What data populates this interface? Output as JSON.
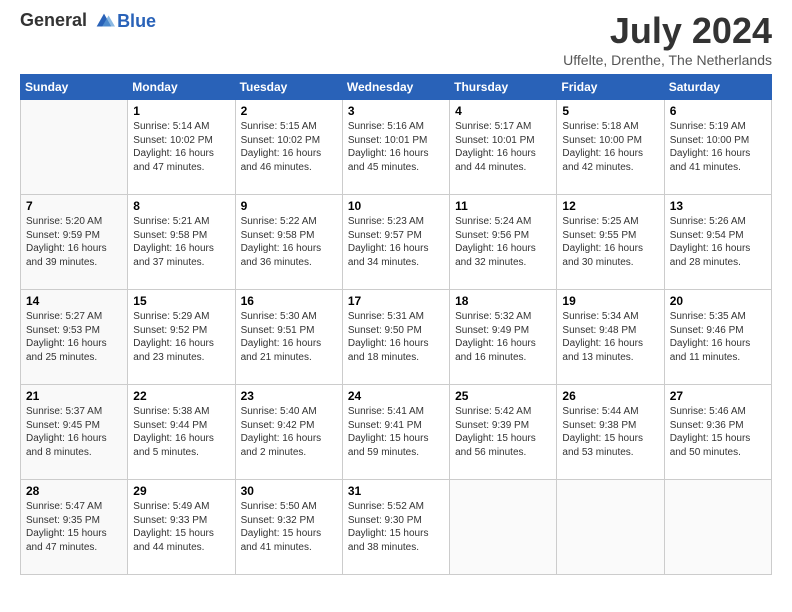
{
  "header": {
    "logo_line1": "General",
    "logo_line2": "Blue",
    "month": "July 2024",
    "location": "Uffelte, Drenthe, The Netherlands"
  },
  "days_of_week": [
    "Sunday",
    "Monday",
    "Tuesday",
    "Wednesday",
    "Thursday",
    "Friday",
    "Saturday"
  ],
  "weeks": [
    [
      {
        "num": "",
        "info": ""
      },
      {
        "num": "1",
        "info": "Sunrise: 5:14 AM\nSunset: 10:02 PM\nDaylight: 16 hours\nand 47 minutes."
      },
      {
        "num": "2",
        "info": "Sunrise: 5:15 AM\nSunset: 10:02 PM\nDaylight: 16 hours\nand 46 minutes."
      },
      {
        "num": "3",
        "info": "Sunrise: 5:16 AM\nSunset: 10:01 PM\nDaylight: 16 hours\nand 45 minutes."
      },
      {
        "num": "4",
        "info": "Sunrise: 5:17 AM\nSunset: 10:01 PM\nDaylight: 16 hours\nand 44 minutes."
      },
      {
        "num": "5",
        "info": "Sunrise: 5:18 AM\nSunset: 10:00 PM\nDaylight: 16 hours\nand 42 minutes."
      },
      {
        "num": "6",
        "info": "Sunrise: 5:19 AM\nSunset: 10:00 PM\nDaylight: 16 hours\nand 41 minutes."
      }
    ],
    [
      {
        "num": "7",
        "info": "Sunrise: 5:20 AM\nSunset: 9:59 PM\nDaylight: 16 hours\nand 39 minutes."
      },
      {
        "num": "8",
        "info": "Sunrise: 5:21 AM\nSunset: 9:58 PM\nDaylight: 16 hours\nand 37 minutes."
      },
      {
        "num": "9",
        "info": "Sunrise: 5:22 AM\nSunset: 9:58 PM\nDaylight: 16 hours\nand 36 minutes."
      },
      {
        "num": "10",
        "info": "Sunrise: 5:23 AM\nSunset: 9:57 PM\nDaylight: 16 hours\nand 34 minutes."
      },
      {
        "num": "11",
        "info": "Sunrise: 5:24 AM\nSunset: 9:56 PM\nDaylight: 16 hours\nand 32 minutes."
      },
      {
        "num": "12",
        "info": "Sunrise: 5:25 AM\nSunset: 9:55 PM\nDaylight: 16 hours\nand 30 minutes."
      },
      {
        "num": "13",
        "info": "Sunrise: 5:26 AM\nSunset: 9:54 PM\nDaylight: 16 hours\nand 28 minutes."
      }
    ],
    [
      {
        "num": "14",
        "info": "Sunrise: 5:27 AM\nSunset: 9:53 PM\nDaylight: 16 hours\nand 25 minutes."
      },
      {
        "num": "15",
        "info": "Sunrise: 5:29 AM\nSunset: 9:52 PM\nDaylight: 16 hours\nand 23 minutes."
      },
      {
        "num": "16",
        "info": "Sunrise: 5:30 AM\nSunset: 9:51 PM\nDaylight: 16 hours\nand 21 minutes."
      },
      {
        "num": "17",
        "info": "Sunrise: 5:31 AM\nSunset: 9:50 PM\nDaylight: 16 hours\nand 18 minutes."
      },
      {
        "num": "18",
        "info": "Sunrise: 5:32 AM\nSunset: 9:49 PM\nDaylight: 16 hours\nand 16 minutes."
      },
      {
        "num": "19",
        "info": "Sunrise: 5:34 AM\nSunset: 9:48 PM\nDaylight: 16 hours\nand 13 minutes."
      },
      {
        "num": "20",
        "info": "Sunrise: 5:35 AM\nSunset: 9:46 PM\nDaylight: 16 hours\nand 11 minutes."
      }
    ],
    [
      {
        "num": "21",
        "info": "Sunrise: 5:37 AM\nSunset: 9:45 PM\nDaylight: 16 hours\nand 8 minutes."
      },
      {
        "num": "22",
        "info": "Sunrise: 5:38 AM\nSunset: 9:44 PM\nDaylight: 16 hours\nand 5 minutes."
      },
      {
        "num": "23",
        "info": "Sunrise: 5:40 AM\nSunset: 9:42 PM\nDaylight: 16 hours\nand 2 minutes."
      },
      {
        "num": "24",
        "info": "Sunrise: 5:41 AM\nSunset: 9:41 PM\nDaylight: 15 hours\nand 59 minutes."
      },
      {
        "num": "25",
        "info": "Sunrise: 5:42 AM\nSunset: 9:39 PM\nDaylight: 15 hours\nand 56 minutes."
      },
      {
        "num": "26",
        "info": "Sunrise: 5:44 AM\nSunset: 9:38 PM\nDaylight: 15 hours\nand 53 minutes."
      },
      {
        "num": "27",
        "info": "Sunrise: 5:46 AM\nSunset: 9:36 PM\nDaylight: 15 hours\nand 50 minutes."
      }
    ],
    [
      {
        "num": "28",
        "info": "Sunrise: 5:47 AM\nSunset: 9:35 PM\nDaylight: 15 hours\nand 47 minutes."
      },
      {
        "num": "29",
        "info": "Sunrise: 5:49 AM\nSunset: 9:33 PM\nDaylight: 15 hours\nand 44 minutes."
      },
      {
        "num": "30",
        "info": "Sunrise: 5:50 AM\nSunset: 9:32 PM\nDaylight: 15 hours\nand 41 minutes."
      },
      {
        "num": "31",
        "info": "Sunrise: 5:52 AM\nSunset: 9:30 PM\nDaylight: 15 hours\nand 38 minutes."
      },
      {
        "num": "",
        "info": ""
      },
      {
        "num": "",
        "info": ""
      },
      {
        "num": "",
        "info": ""
      }
    ]
  ]
}
